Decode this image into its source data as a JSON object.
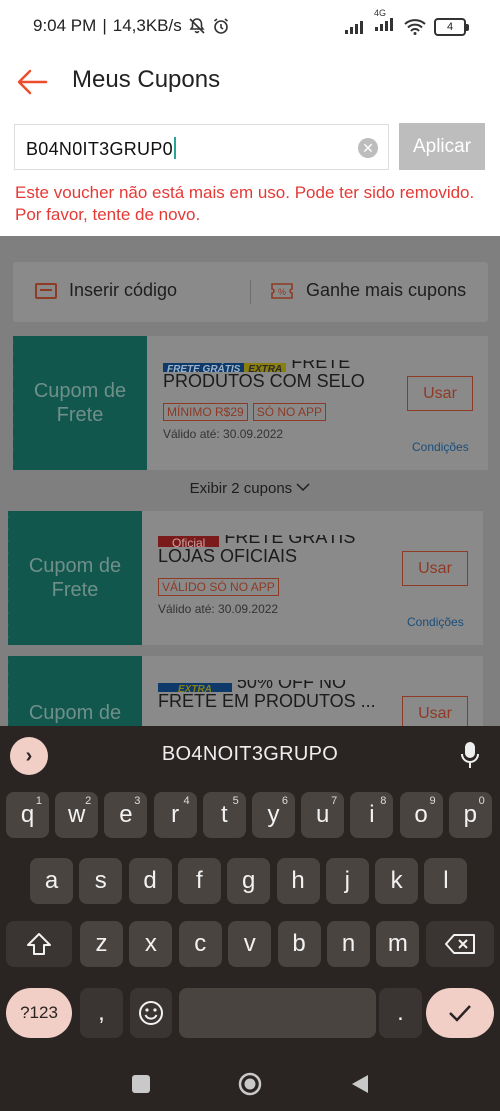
{
  "status_bar": {
    "time": "9:04 PM",
    "speed": "14,3KB/s",
    "network": "4G",
    "battery": "4"
  },
  "header": {
    "title": "Meus Cupons"
  },
  "voucher_input": {
    "value": "B04N0IT3GRUP0",
    "apply_label": "Aplicar"
  },
  "error_message": "Este voucher não está mais em uso. Pode ter sido removido. Por favor, tente de novo.",
  "tabs": {
    "insert_code": "Inserir código",
    "earn_more": "Ganhe mais cupons"
  },
  "coupons": [
    {
      "left_label": "Cupom de Frete",
      "badge_1": "FRETE GRÁTIS",
      "badge_2": "EXTRA",
      "title_top": "FRETE GRÁTIS",
      "title_main": "PRODUTOS COM SELO",
      "tags": [
        "MÍNIMO R$29",
        "SÓ NO APP"
      ],
      "valid": "Válido até: 30.09.2022",
      "use_label": "Usar",
      "conditions": "Condições"
    },
    {
      "left_label": "Cupom de Frete",
      "badge_1": "Oficial",
      "title_top": "FRETE GRÁTIS",
      "title_main": "LOJAS OFICIAIS",
      "tags": [
        "VÁLIDO SÓ NO APP"
      ],
      "valid": "Válido até: 30.09.2022",
      "use_label": "Usar",
      "conditions": "Condições"
    },
    {
      "left_label": "Cupom de",
      "badge_1": "EXTRA",
      "title_top": "50% OFF NO",
      "title_main": "FRETE EM PRODUTOS ...",
      "use_label": "Usar"
    }
  ],
  "show_more": "Exibir 2 cupons",
  "keyboard": {
    "suggestion": "BO4NOIT3GRUPO",
    "row1": [
      {
        "k": "q",
        "n": "1"
      },
      {
        "k": "w",
        "n": "2"
      },
      {
        "k": "e",
        "n": "3"
      },
      {
        "k": "r",
        "n": "4"
      },
      {
        "k": "t",
        "n": "5"
      },
      {
        "k": "y",
        "n": "6"
      },
      {
        "k": "u",
        "n": "7"
      },
      {
        "k": "i",
        "n": "8"
      },
      {
        "k": "o",
        "n": "9"
      },
      {
        "k": "p",
        "n": "0"
      }
    ],
    "row2": [
      "a",
      "s",
      "d",
      "f",
      "g",
      "h",
      "j",
      "k",
      "l"
    ],
    "row3": [
      "z",
      "x",
      "c",
      "v",
      "b",
      "n",
      "m"
    ],
    "symbols_label": "?123",
    "comma": ",",
    "period": "."
  },
  "colors": {
    "accent": "#ee4d2d",
    "error": "#e53935",
    "coupon_green": "#26a69a",
    "keyboard_bg": "#2a2523"
  }
}
